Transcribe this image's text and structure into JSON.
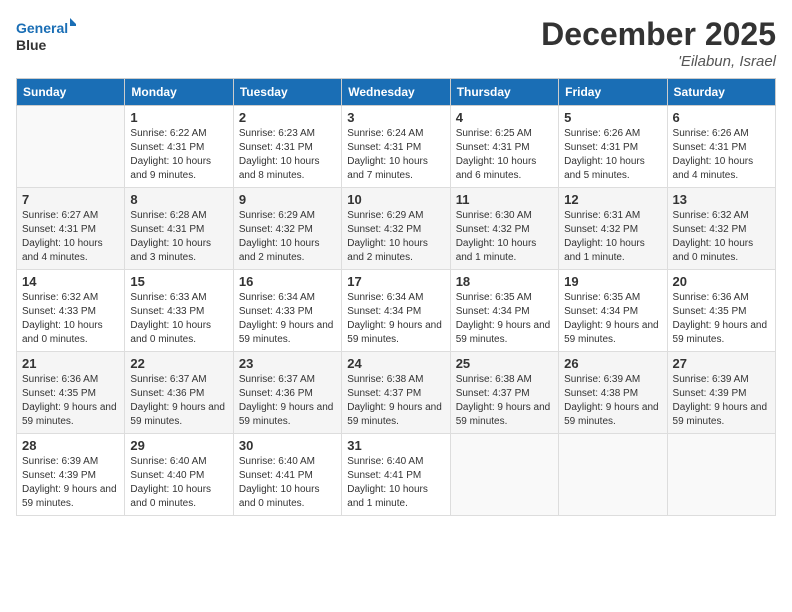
{
  "header": {
    "logo_line1": "General",
    "logo_line2": "Blue",
    "month": "December 2025",
    "location": "'Eilabun, Israel"
  },
  "weekdays": [
    "Sunday",
    "Monday",
    "Tuesday",
    "Wednesday",
    "Thursday",
    "Friday",
    "Saturday"
  ],
  "weeks": [
    [
      {
        "day": "",
        "info": ""
      },
      {
        "day": "1",
        "info": "Sunrise: 6:22 AM\nSunset: 4:31 PM\nDaylight: 10 hours\nand 9 minutes."
      },
      {
        "day": "2",
        "info": "Sunrise: 6:23 AM\nSunset: 4:31 PM\nDaylight: 10 hours\nand 8 minutes."
      },
      {
        "day": "3",
        "info": "Sunrise: 6:24 AM\nSunset: 4:31 PM\nDaylight: 10 hours\nand 7 minutes."
      },
      {
        "day": "4",
        "info": "Sunrise: 6:25 AM\nSunset: 4:31 PM\nDaylight: 10 hours\nand 6 minutes."
      },
      {
        "day": "5",
        "info": "Sunrise: 6:26 AM\nSunset: 4:31 PM\nDaylight: 10 hours\nand 5 minutes."
      },
      {
        "day": "6",
        "info": "Sunrise: 6:26 AM\nSunset: 4:31 PM\nDaylight: 10 hours\nand 4 minutes."
      }
    ],
    [
      {
        "day": "7",
        "info": "Sunrise: 6:27 AM\nSunset: 4:31 PM\nDaylight: 10 hours\nand 4 minutes."
      },
      {
        "day": "8",
        "info": "Sunrise: 6:28 AM\nSunset: 4:31 PM\nDaylight: 10 hours\nand 3 minutes."
      },
      {
        "day": "9",
        "info": "Sunrise: 6:29 AM\nSunset: 4:32 PM\nDaylight: 10 hours\nand 2 minutes."
      },
      {
        "day": "10",
        "info": "Sunrise: 6:29 AM\nSunset: 4:32 PM\nDaylight: 10 hours\nand 2 minutes."
      },
      {
        "day": "11",
        "info": "Sunrise: 6:30 AM\nSunset: 4:32 PM\nDaylight: 10 hours\nand 1 minute."
      },
      {
        "day": "12",
        "info": "Sunrise: 6:31 AM\nSunset: 4:32 PM\nDaylight: 10 hours\nand 1 minute."
      },
      {
        "day": "13",
        "info": "Sunrise: 6:32 AM\nSunset: 4:32 PM\nDaylight: 10 hours\nand 0 minutes."
      }
    ],
    [
      {
        "day": "14",
        "info": "Sunrise: 6:32 AM\nSunset: 4:33 PM\nDaylight: 10 hours\nand 0 minutes."
      },
      {
        "day": "15",
        "info": "Sunrise: 6:33 AM\nSunset: 4:33 PM\nDaylight: 10 hours\nand 0 minutes."
      },
      {
        "day": "16",
        "info": "Sunrise: 6:34 AM\nSunset: 4:33 PM\nDaylight: 9 hours\nand 59 minutes."
      },
      {
        "day": "17",
        "info": "Sunrise: 6:34 AM\nSunset: 4:34 PM\nDaylight: 9 hours\nand 59 minutes."
      },
      {
        "day": "18",
        "info": "Sunrise: 6:35 AM\nSunset: 4:34 PM\nDaylight: 9 hours\nand 59 minutes."
      },
      {
        "day": "19",
        "info": "Sunrise: 6:35 AM\nSunset: 4:34 PM\nDaylight: 9 hours\nand 59 minutes."
      },
      {
        "day": "20",
        "info": "Sunrise: 6:36 AM\nSunset: 4:35 PM\nDaylight: 9 hours\nand 59 minutes."
      }
    ],
    [
      {
        "day": "21",
        "info": "Sunrise: 6:36 AM\nSunset: 4:35 PM\nDaylight: 9 hours\nand 59 minutes."
      },
      {
        "day": "22",
        "info": "Sunrise: 6:37 AM\nSunset: 4:36 PM\nDaylight: 9 hours\nand 59 minutes."
      },
      {
        "day": "23",
        "info": "Sunrise: 6:37 AM\nSunset: 4:36 PM\nDaylight: 9 hours\nand 59 minutes."
      },
      {
        "day": "24",
        "info": "Sunrise: 6:38 AM\nSunset: 4:37 PM\nDaylight: 9 hours\nand 59 minutes."
      },
      {
        "day": "25",
        "info": "Sunrise: 6:38 AM\nSunset: 4:37 PM\nDaylight: 9 hours\nand 59 minutes."
      },
      {
        "day": "26",
        "info": "Sunrise: 6:39 AM\nSunset: 4:38 PM\nDaylight: 9 hours\nand 59 minutes."
      },
      {
        "day": "27",
        "info": "Sunrise: 6:39 AM\nSunset: 4:39 PM\nDaylight: 9 hours\nand 59 minutes."
      }
    ],
    [
      {
        "day": "28",
        "info": "Sunrise: 6:39 AM\nSunset: 4:39 PM\nDaylight: 9 hours\nand 59 minutes."
      },
      {
        "day": "29",
        "info": "Sunrise: 6:40 AM\nSunset: 4:40 PM\nDaylight: 10 hours\nand 0 minutes."
      },
      {
        "day": "30",
        "info": "Sunrise: 6:40 AM\nSunset: 4:41 PM\nDaylight: 10 hours\nand 0 minutes."
      },
      {
        "day": "31",
        "info": "Sunrise: 6:40 AM\nSunset: 4:41 PM\nDaylight: 10 hours\nand 1 minute."
      },
      {
        "day": "",
        "info": ""
      },
      {
        "day": "",
        "info": ""
      },
      {
        "day": "",
        "info": ""
      }
    ]
  ]
}
